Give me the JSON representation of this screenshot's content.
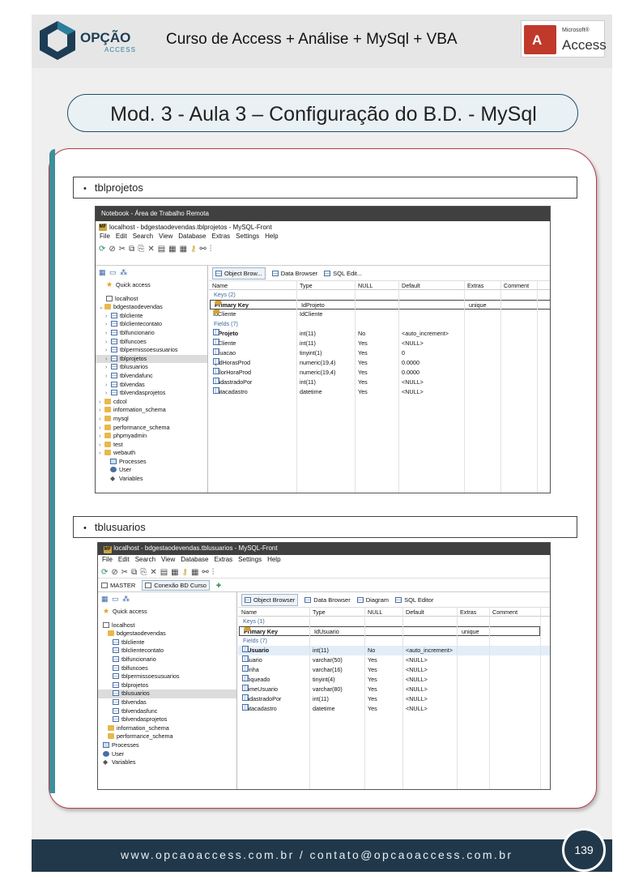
{
  "header": {
    "logo_text": "OPÇÃO",
    "logo_sub": "ACCESS",
    "course_title": "Curso de Access + Análise + MySql + VBA",
    "access_logo_ms": "Microsoft®",
    "access_logo_name": "Access",
    "access_logo_letter": "A"
  },
  "module_title": "Mod. 3 - Aula 3 – Configuração do B.D. - MySql",
  "section1": {
    "label": "tblprojetos",
    "rdp_title": "Notebook - Área de Trabalho Remota",
    "window_title": "localhost - bdgestaodevendas.tblprojetos - MySQL-Front",
    "menu": [
      "File",
      "Edit",
      "Search",
      "View",
      "Database",
      "Extras",
      "Settings",
      "Help"
    ],
    "view_tabs": [
      "Object Brow...",
      "Data Browser",
      "SQL Edit..."
    ],
    "tree": {
      "quick_access": "Quick access",
      "host": "localhost",
      "db": "bdgestaodevendas",
      "tables": [
        "tblcliente",
        "tblclientecontato",
        "tblfuncionario",
        "tblfuncoes",
        "tblpermissoesusuarios",
        "tblprojetos",
        "tblusuarios",
        "tblvendafunc",
        "tblvendas",
        "tblvendasprojetos"
      ],
      "other_dbs": [
        "cdcol",
        "information_schema",
        "mysql",
        "performance_schema",
        "phpmyadmin",
        "test",
        "webauth"
      ],
      "extras": [
        "Processes",
        "User",
        "Variables"
      ]
    },
    "columns": [
      "Name",
      "Type",
      "NULL",
      "Default",
      "Extras",
      "Comment"
    ],
    "keys_label": "Keys (2)",
    "keys": [
      {
        "name": "Primary Key",
        "type": "IdProjeto",
        "extras": "unique"
      },
      {
        "name": "IdCliente",
        "type": "IdCliente",
        "extras": ""
      }
    ],
    "fields_label": "Fields (7)",
    "fields": [
      {
        "name": "IdProjeto",
        "type": "int(11)",
        "null": "No",
        "default": "<auto_increment>"
      },
      {
        "name": "IdCliente",
        "type": "int(11)",
        "null": "Yes",
        "default": "<NULL>"
      },
      {
        "name": "Situacao",
        "type": "tinyint(1)",
        "null": "Yes",
        "default": "0"
      },
      {
        "name": "QtdHorasProd",
        "type": "numeric(19,4)",
        "null": "Yes",
        "default": "0.0000"
      },
      {
        "name": "ValorHoraProd",
        "type": "numeric(19,4)",
        "null": "Yes",
        "default": "0.0000"
      },
      {
        "name": "CadastradoPor",
        "type": "int(11)",
        "null": "Yes",
        "default": "<NULL>"
      },
      {
        "name": "Datacadastro",
        "type": "datetime",
        "null": "Yes",
        "default": "<NULL>"
      }
    ]
  },
  "section2": {
    "label": "tblusuarios",
    "window_title": "localhost - bdgestaodevendas.tblusuarios - MySQL-Front",
    "menu": [
      "File",
      "Edit",
      "Search",
      "View",
      "Database",
      "Extras",
      "Settings",
      "Help"
    ],
    "conn_tabs": [
      "MASTER",
      "Conexão BD Curso"
    ],
    "view_tabs": [
      "Object Browser",
      "Data Browser",
      "Diagram",
      "SQL Editor"
    ],
    "tree": {
      "quick_access": "Quick access",
      "host": "localhost",
      "db": "bdgestaodevendas",
      "tables": [
        "tblcliente",
        "tblclientecontato",
        "tblfuncionario",
        "tblfuncoes",
        "tblpermissoesusuarios",
        "tblprojetos",
        "tblusuarios",
        "tblvendas",
        "tblvendasfunc",
        "tblvendasprojetos"
      ],
      "other_dbs": [
        "information_schema",
        "performance_schema"
      ],
      "extras": [
        "Processes",
        "User",
        "Variables"
      ]
    },
    "columns": [
      "Name",
      "Type",
      "NULL",
      "Default",
      "Extras",
      "Comment"
    ],
    "keys_label": "Keys (1)",
    "keys": [
      {
        "name": "Primary Key",
        "type": "IdUsuario",
        "extras": "unique"
      }
    ],
    "fields_label": "Fields (7)",
    "fields": [
      {
        "name": "IdUsuario",
        "type": "int(11)",
        "null": "No",
        "default": "<auto_increment>"
      },
      {
        "name": "Usuario",
        "type": "varchar(50)",
        "null": "Yes",
        "default": "<NULL>"
      },
      {
        "name": "Senha",
        "type": "varchar(16)",
        "null": "Yes",
        "default": "<NULL>"
      },
      {
        "name": "Bloqueado",
        "type": "tinyint(4)",
        "null": "Yes",
        "default": "<NULL>"
      },
      {
        "name": "NomeUsuario",
        "type": "varchar(80)",
        "null": "Yes",
        "default": "<NULL>"
      },
      {
        "name": "CadastradoPor",
        "type": "int(11)",
        "null": "Yes",
        "default": "<NULL>"
      },
      {
        "name": "Datacadastro",
        "type": "datetime",
        "null": "Yes",
        "default": "<NULL>"
      }
    ]
  },
  "footer": {
    "text": "www.opcaoaccess.com.br / contato@opcaoaccess.com.br",
    "page_number": "139"
  }
}
